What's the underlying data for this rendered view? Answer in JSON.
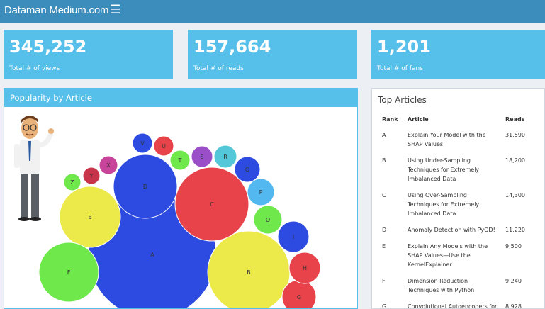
{
  "header": {
    "brand": "Dataman Medium.com",
    "menu_icon": "hamburger-menu-icon"
  },
  "stats": [
    {
      "value": "345,252",
      "label": "Total # of views"
    },
    {
      "value": "157,664",
      "label": "Total # of reads"
    },
    {
      "value": "1,201",
      "label": "Total # of fans"
    }
  ],
  "popularity": {
    "title": "Popularity by Article",
    "bubbles": [
      {
        "label": "A",
        "color": "#2d4be0"
      },
      {
        "label": "B",
        "color": "#ecea4a"
      },
      {
        "label": "C",
        "color": "#e8434a"
      },
      {
        "label": "D",
        "color": "#2d4be0"
      },
      {
        "label": "E",
        "color": "#ecea4a"
      },
      {
        "label": "F",
        "color": "#6ee84a"
      },
      {
        "label": "G",
        "color": "#e8434a"
      },
      {
        "label": "H",
        "color": "#e8434a"
      },
      {
        "label": "I",
        "color": "#2d4be0"
      },
      {
        "label": "O",
        "color": "#6ee84a"
      },
      {
        "label": "P",
        "color": "#54b8f0"
      },
      {
        "label": "Q",
        "color": "#2d4be0"
      },
      {
        "label": "R",
        "color": "#54c8d8"
      },
      {
        "label": "S",
        "color": "#9a4ec8"
      },
      {
        "label": "T",
        "color": "#6ee84a"
      },
      {
        "label": "U",
        "color": "#e8434a"
      },
      {
        "label": "V",
        "color": "#2d4be0"
      },
      {
        "label": "X",
        "color": "#c8449a"
      },
      {
        "label": "Y",
        "color": "#c8344a"
      },
      {
        "label": "Z",
        "color": "#6ee84a"
      }
    ]
  },
  "top_articles": {
    "title": "Top Articles",
    "columns": [
      "Rank",
      "Article",
      "Reads"
    ],
    "rows": [
      {
        "rank": "A",
        "article": "Explain Your Model with the SHAP Values",
        "reads": "31,590"
      },
      {
        "rank": "B",
        "article": "Using Under-Sampling Techniques for Extremely Imbalanced Data",
        "reads": "18,200"
      },
      {
        "rank": "C",
        "article": "Using Over-Sampling Techniques for Extremely Imbalanced Data",
        "reads": "14,300"
      },
      {
        "rank": "D",
        "article": "Anomaly Detection with PyOD!",
        "reads": "11,220"
      },
      {
        "rank": "E",
        "article": "Explain Any Models with the SHAP Values—Use the KernelExplainer",
        "reads": "9,500"
      },
      {
        "rank": "F",
        "article": "Dimension Reduction Techniques with Python",
        "reads": "9,240"
      },
      {
        "rank": "G",
        "article": "Convolutional Autoencoders for",
        "reads": "8,928"
      }
    ]
  }
}
